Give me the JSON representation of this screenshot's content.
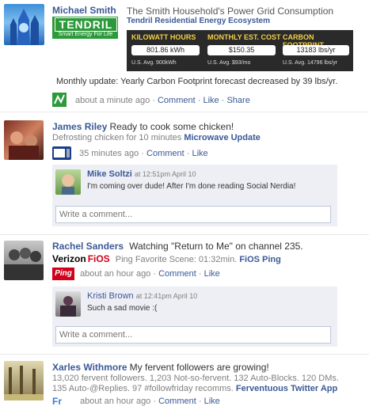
{
  "posts": [
    {
      "author": "Michael Smith",
      "logo_text": "TENDRIL",
      "logo_tagline": "Smart Energy For Life",
      "title": "The Smith Household's Power Grid Consumption",
      "subtitle": "Tendril Residential Energy Ecosystem",
      "stats": [
        {
          "label": "KILOWATT HOURS",
          "value": "801.86 kWh",
          "avg": "U.S. Avg. 900kWh"
        },
        {
          "label": "MONTHLY EST. COST",
          "value": "$150.35",
          "avg": "U.S. Avg. $93/mo"
        },
        {
          "label": "CARBON FOOTPRINT",
          "value": "13183 lbs/yr",
          "avg": "U.S. Avg. 14796 lbs/yr"
        }
      ],
      "body": "Monthly update: Yearly Carbon Footprint forecast decreased by 39 lbs/yr.",
      "time": "about a minute ago",
      "actions": [
        "Comment",
        "Like",
        "Share"
      ]
    },
    {
      "author": "James Riley",
      "status": "Ready to cook some chicken!",
      "detail_text": "Defrosting chicken for 10 minutes",
      "detail_app": "Microwave Update",
      "time": "35 minutes ago",
      "actions": [
        "Comment",
        "Like"
      ],
      "comment": {
        "author": "Mike Soltzi",
        "time": "at 12:51pm April 10",
        "text": "I'm coming over dude! After I'm done reading Social Nerdia!"
      },
      "comment_placeholder": "Write a comment..."
    },
    {
      "author": "Rachel Sanders",
      "status": "Watching \"Return to Me\" on channel 235.",
      "brand_verizon": "Verizon",
      "brand_fios": "FiOS",
      "detail_text": "Ping Favorite Scene: 01:32min.",
      "detail_app": "FiOS Ping",
      "ping_label": "Ping",
      "time": "about an hour ago",
      "actions": [
        "Comment",
        "Like"
      ],
      "comment": {
        "author": "Kristi Brown",
        "time": "at 12:41pm April 10",
        "text": "Such a sad movie :("
      },
      "comment_placeholder": "Write a comment..."
    },
    {
      "author": "Xarles Withmore",
      "status": "My fervent followers are growing!",
      "detail_line1": "13,020 fervent followers. 1,203 Not-so-fervent. 132 Auto-Blocks. 120 DMs.",
      "detail_line2": "135 Auto-@Replies. 97 #followfriday recomms.",
      "detail_app": "Ferventuous Twitter App",
      "app_label": "Fr",
      "time": "about an hour ago",
      "actions": [
        "Comment",
        "Like"
      ]
    }
  ],
  "colors": {
    "link": "#3b5998",
    "comment_bg": "#edeff4",
    "tendril_green": "#2c9a3a",
    "tendril_yellow": "#f2d049",
    "fios_red": "#d0021b"
  }
}
